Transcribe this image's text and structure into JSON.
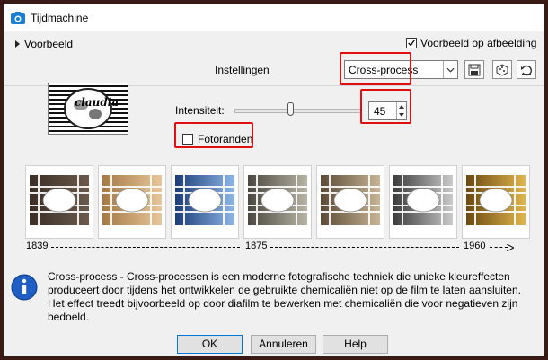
{
  "window": {
    "title": "Tijdmachine",
    "icon": "camera-icon"
  },
  "preview": {
    "label": "Voorbeeld",
    "checkbox_label": "Voorbeeld op afbeelding",
    "checkbox_checked": true
  },
  "settings": {
    "label": "Instellingen",
    "preset_value": "Cross-process",
    "tools": [
      "save-icon",
      "randomize-icon",
      "reset-icon"
    ]
  },
  "thumbnail": {
    "text": "claudia"
  },
  "intensity": {
    "label": "Intensiteit:",
    "value": "45",
    "slider_fraction": 0.45
  },
  "photo_edges": {
    "label": "Fotoranden",
    "checked": false
  },
  "swatches": [
    {
      "name": "1839",
      "colors": [
        "#3a2e26",
        "#6b5a4c"
      ]
    },
    {
      "name": "mid-1",
      "colors": [
        "#a57a45",
        "#e7c79a"
      ]
    },
    {
      "name": "mid-2",
      "colors": [
        "#1c3d78",
        "#8fb5e6"
      ]
    },
    {
      "name": "1875",
      "colors": [
        "#4a4840",
        "#b7b4a4"
      ]
    },
    {
      "name": "mid-3",
      "colors": [
        "#5b4a36",
        "#c8b595"
      ]
    },
    {
      "name": "mid-4",
      "colors": [
        "#3c3c3c",
        "#cacaca"
      ]
    },
    {
      "name": "1960",
      "colors": [
        "#6b4a12",
        "#e0b54c"
      ]
    }
  ],
  "timeline": {
    "years": [
      "1839",
      "1875",
      "1960"
    ]
  },
  "info": {
    "icon": "info-icon",
    "text": "Cross-process - Cross-processen is een moderne fotografische techniek die unieke kleureffecten produceert door tijdens het ontwikkelen de gebruikte chemicaliën niet op de film te laten aansluiten. Het effect treedt bijvoorbeeld op door diafilm te bewerken met chemicaliën die voor negatieven zijn bedoeld."
  },
  "buttons": {
    "ok": "OK",
    "cancel": "Annuleren",
    "help": "Help"
  },
  "colors": {
    "highlight": "#e01010",
    "background": "#f0f0f0",
    "frame": "#3a1a14"
  }
}
